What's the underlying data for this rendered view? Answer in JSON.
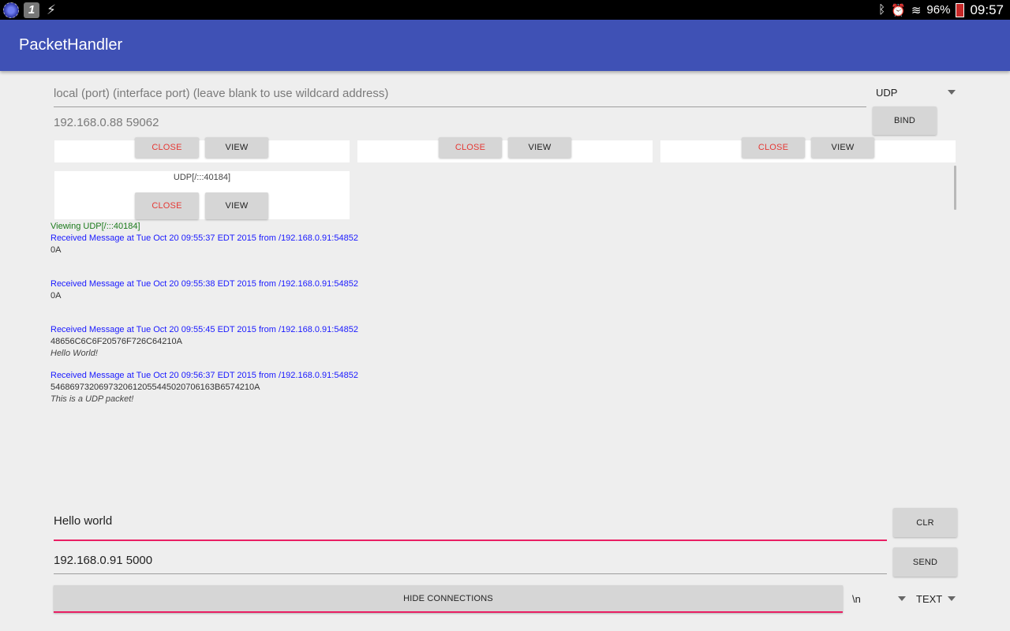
{
  "status_bar": {
    "battery": "96%",
    "time": "09:57",
    "icons": [
      "app-notification-icon",
      "numbered-notification-icon",
      "flash-icon",
      "bluetooth-icon",
      "alarm-icon",
      "wifi-icon",
      "battery-icon"
    ]
  },
  "app": {
    "title": "PacketHandler"
  },
  "bind_section": {
    "local_input_placeholder": "local (port) (interface port) (leave blank to use wildcard address)",
    "remote_input_placeholder": "192.168.0.88 59062",
    "protocol": "UDP",
    "bind_label": "BIND"
  },
  "connections": [
    {
      "title": "",
      "close_label": "CLOSE",
      "view_label": "VIEW"
    },
    {
      "title": "",
      "close_label": "CLOSE",
      "view_label": "VIEW"
    },
    {
      "title": "",
      "close_label": "CLOSE",
      "view_label": "VIEW"
    },
    {
      "title": "UDP[/:::40184]",
      "close_label": "CLOSE",
      "view_label": "VIEW"
    }
  ],
  "log": {
    "viewing": "Viewing UDP[/:::40184]",
    "messages": [
      {
        "header": "Received Message at Tue Oct 20 09:55:37 EDT 2015 from /192.168.0.91:54852",
        "hex": "0A",
        "text": ""
      },
      {
        "header": "Received Message at Tue Oct 20 09:55:38 EDT 2015 from /192.168.0.91:54852",
        "hex": "0A",
        "text": ""
      },
      {
        "header": "Received Message at Tue Oct 20 09:55:45 EDT 2015 from /192.168.0.91:54852",
        "hex": "48656C6C6F20576F726C64210A",
        "text": "Hello World!"
      },
      {
        "header": "Received Message at Tue Oct 20 09:56:37 EDT 2015 from /192.168.0.91:54852",
        "hex": "5468697320697320612055445020706163B6574210A",
        "text": "This is a UDP packet!"
      }
    ]
  },
  "send_section": {
    "message_value": "Hello world",
    "destination_value": "192.168.0.91 5000",
    "clr_label": "CLR",
    "send_label": "SEND",
    "toggle_label": "HIDE CONNECTIONS",
    "line_ending": "\\n",
    "format": "TEXT"
  },
  "colors": {
    "app_bar": "#3f51b5",
    "accent": "#e91e63",
    "message_header": "#1a1aff",
    "viewing": "#1b7a1b",
    "close_text": "#e53935"
  }
}
